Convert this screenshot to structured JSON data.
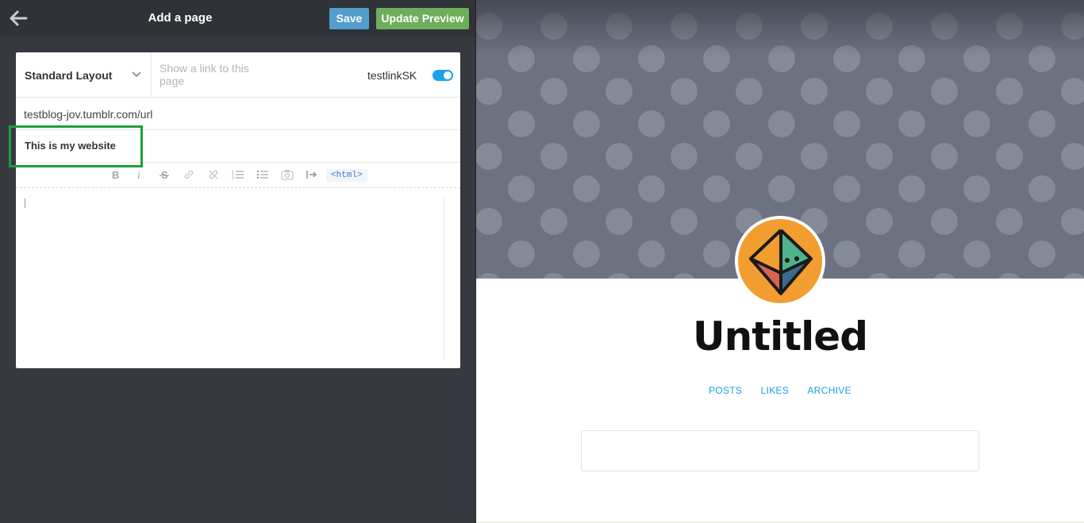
{
  "editor": {
    "title": "Add a page",
    "save_label": "Save",
    "preview_label": "Update Preview",
    "layout_label": "Standard Layout",
    "link_placeholder": "Show a link to this page",
    "toggle_label": "testlinkSK",
    "toggle_on": true,
    "url": "testblog-jov.tumblr.com/url",
    "page_title_value": "This is my website",
    "html_label": "<html>",
    "body_value": ""
  },
  "preview": {
    "blog_title": "Untitled",
    "nav": [
      "POSTS",
      "LIKES",
      "ARCHIVE"
    ]
  },
  "colors": {
    "save_button": "#529ecc",
    "preview_button": "#6cae59",
    "toggle": "#1aa3e8",
    "nav_link": "#1a9ee0",
    "avatar_bg": "#f29d2f",
    "highlight": "#1e9e3e"
  },
  "icons": {
    "back": "arrow-left-icon",
    "layout_dropdown": "chevron-down-icon",
    "toolbar": [
      "bold-icon",
      "italic-icon",
      "strikethrough-icon",
      "link-icon",
      "unlink-icon",
      "ordered-list-icon",
      "bullet-list-icon",
      "camera-icon",
      "read-more-icon"
    ]
  }
}
